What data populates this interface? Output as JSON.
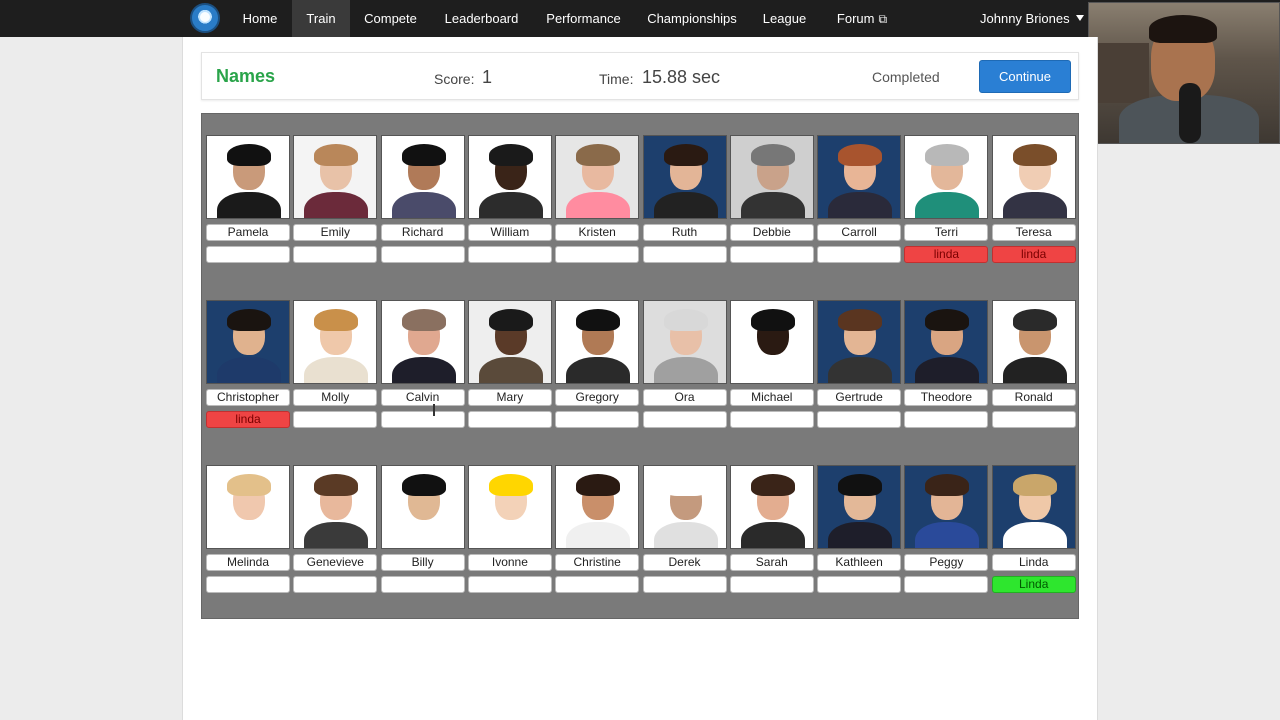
{
  "nav": {
    "items": [
      {
        "label": "Home",
        "active": false
      },
      {
        "label": "Train",
        "active": true
      },
      {
        "label": "Compete",
        "active": false
      },
      {
        "label": "Leaderboard",
        "active": false
      },
      {
        "label": "Performance",
        "active": false
      },
      {
        "label": "Championships",
        "active": false
      },
      {
        "label": "League",
        "active": false
      },
      {
        "label": "Forum",
        "active": false,
        "external": true
      }
    ],
    "user": "Johnny Briones"
  },
  "status": {
    "title": "Names",
    "score_label": "Score:",
    "score": "1",
    "time_label": "Time:",
    "time": "15.88 sec",
    "state": "Completed",
    "continue_label": "Continue"
  },
  "cards": [
    {
      "name": "Pamela",
      "answer": "",
      "result": "none",
      "skin": "#c99a7a",
      "hair": "#111111",
      "shirt": "#1a1a1a",
      "bg": "#ffffff"
    },
    {
      "name": "Emily",
      "answer": "",
      "result": "none",
      "skin": "#e8c2a8",
      "hair": "#b9875a",
      "shirt": "#6b2a3a",
      "bg": "#f4f4f4"
    },
    {
      "name": "Richard",
      "answer": "",
      "result": "none",
      "skin": "#b07a58",
      "hair": "#111111",
      "shirt": "#4a4b6a",
      "bg": "#ffffff"
    },
    {
      "name": "William",
      "answer": "",
      "result": "none",
      "skin": "#3a2418",
      "hair": "#1a1a1a",
      "shirt": "#2c2c2c",
      "bg": "#ffffff"
    },
    {
      "name": "Kristen",
      "answer": "",
      "result": "none",
      "skin": "#e8b9a0",
      "hair": "#8a6a4a",
      "shirt": "#ff8ca0",
      "bg": "#e6e6e6"
    },
    {
      "name": "Ruth",
      "answer": "",
      "result": "none",
      "skin": "#e3b597",
      "hair": "#2a1a12",
      "shirt": "#222222",
      "bg": "#1d3f6d"
    },
    {
      "name": "Debbie",
      "answer": "",
      "result": "none",
      "skin": "#c9a28a",
      "hair": "#777777",
      "shirt": "#333333",
      "bg": "#cfcfcf"
    },
    {
      "name": "Carroll",
      "answer": "",
      "result": "none",
      "skin": "#e8b596",
      "hair": "#a8542e",
      "shirt": "#2a2a3a",
      "bg": "#1d3f6d"
    },
    {
      "name": "Terri",
      "answer": "linda",
      "result": "wrong",
      "skin": "#e3b79a",
      "hair": "#b8b8b8",
      "shirt": "#1f8f7a",
      "bg": "#ffffff"
    },
    {
      "name": "Teresa",
      "answer": "linda",
      "result": "wrong",
      "skin": "#f0cdb4",
      "hair": "#7a4e2a",
      "shirt": "#333344",
      "bg": "#ffffff"
    },
    {
      "name": "Christopher",
      "answer": "linda",
      "result": "wrong",
      "skin": "#e0b28e",
      "hair": "#1a1410",
      "shirt": "#1e3a6a",
      "bg": "#1d3f6d"
    },
    {
      "name": "Molly",
      "answer": "",
      "result": "none",
      "skin": "#efc8aa",
      "hair": "#c9904a",
      "shirt": "#e9e0d0",
      "bg": "#ffffff"
    },
    {
      "name": "Calvin",
      "answer": "",
      "result": "none",
      "skin": "#e0a890",
      "hair": "#8a7060",
      "shirt": "#1e1e2a",
      "bg": "#ffffff"
    },
    {
      "name": "Mary",
      "answer": "",
      "result": "none",
      "skin": "#5a3a28",
      "hair": "#1a1a1a",
      "shirt": "#5a4a3a",
      "bg": "#eeeeee"
    },
    {
      "name": "Gregory",
      "answer": "",
      "result": "none",
      "skin": "#b07a55",
      "hair": "#111111",
      "shirt": "#2a2a2a",
      "bg": "#ffffff"
    },
    {
      "name": "Ora",
      "answer": "",
      "result": "none",
      "skin": "#e8c0a8",
      "hair": "#d8d8d8",
      "shirt": "#a0a0a0",
      "bg": "#dddddd"
    },
    {
      "name": "Michael",
      "answer": "",
      "result": "none",
      "skin": "#2a1a12",
      "hair": "#111111",
      "shirt": "#ffffff",
      "bg": "#ffffff"
    },
    {
      "name": "Gertrude",
      "answer": "",
      "result": "none",
      "skin": "#e3b594",
      "hair": "#5a3520",
      "shirt": "#333333",
      "bg": "#1d3f6d"
    },
    {
      "name": "Theodore",
      "answer": "",
      "result": "none",
      "skin": "#d9a582",
      "hair": "#1a1410",
      "shirt": "#1e1e2a",
      "bg": "#1d3f6d"
    },
    {
      "name": "Ronald",
      "answer": "",
      "result": "none",
      "skin": "#c9956e",
      "hair": "#2a2a2a",
      "shirt": "#222222",
      "bg": "#ffffff"
    },
    {
      "name": "Melinda",
      "answer": "",
      "result": "none",
      "skin": "#f0c8ae",
      "hair": "#e3c08a",
      "shirt": "#ffffff",
      "bg": "#ffffff"
    },
    {
      "name": "Genevieve",
      "answer": "",
      "result": "none",
      "skin": "#e8b89c",
      "hair": "#5a3a25",
      "shirt": "#3a3a3a",
      "bg": "#ffffff"
    },
    {
      "name": "Billy",
      "answer": "",
      "result": "none",
      "skin": "#e0b894",
      "hair": "#111111",
      "shirt": "#ffffff",
      "bg": "#ffffff"
    },
    {
      "name": "Ivonne",
      "answer": "",
      "result": "none",
      "skin": "#f3d2b8",
      "hair": "#ffd600",
      "shirt": "#ffffff",
      "bg": "#ffffff"
    },
    {
      "name": "Christine",
      "answer": "",
      "result": "none",
      "skin": "#c98f6a",
      "hair": "#2a1a12",
      "shirt": "#f0f0f0",
      "bg": "#ffffff"
    },
    {
      "name": "Derek",
      "answer": "",
      "result": "none",
      "skin": "#c49a7e",
      "hair": "#ffffff",
      "shirt": "#e0e0e0",
      "bg": "#ffffff"
    },
    {
      "name": "Sarah",
      "answer": "",
      "result": "none",
      "skin": "#e3ad90",
      "hair": "#3a2418",
      "shirt": "#2a2a2a",
      "bg": "#ffffff"
    },
    {
      "name": "Kathleen",
      "answer": "",
      "result": "none",
      "skin": "#e3b898",
      "hair": "#111111",
      "shirt": "#1e1e2a",
      "bg": "#1d3f6d"
    },
    {
      "name": "Peggy",
      "answer": "",
      "result": "none",
      "skin": "#e3b596",
      "hair": "#3a2418",
      "shirt": "#2a4a9a",
      "bg": "#1d3f6d"
    },
    {
      "name": "Linda",
      "answer": "Linda",
      "result": "correct",
      "skin": "#efc8a8",
      "hair": "#c9a66a",
      "shirt": "#ffffff",
      "bg": "#1d3f6d"
    }
  ]
}
